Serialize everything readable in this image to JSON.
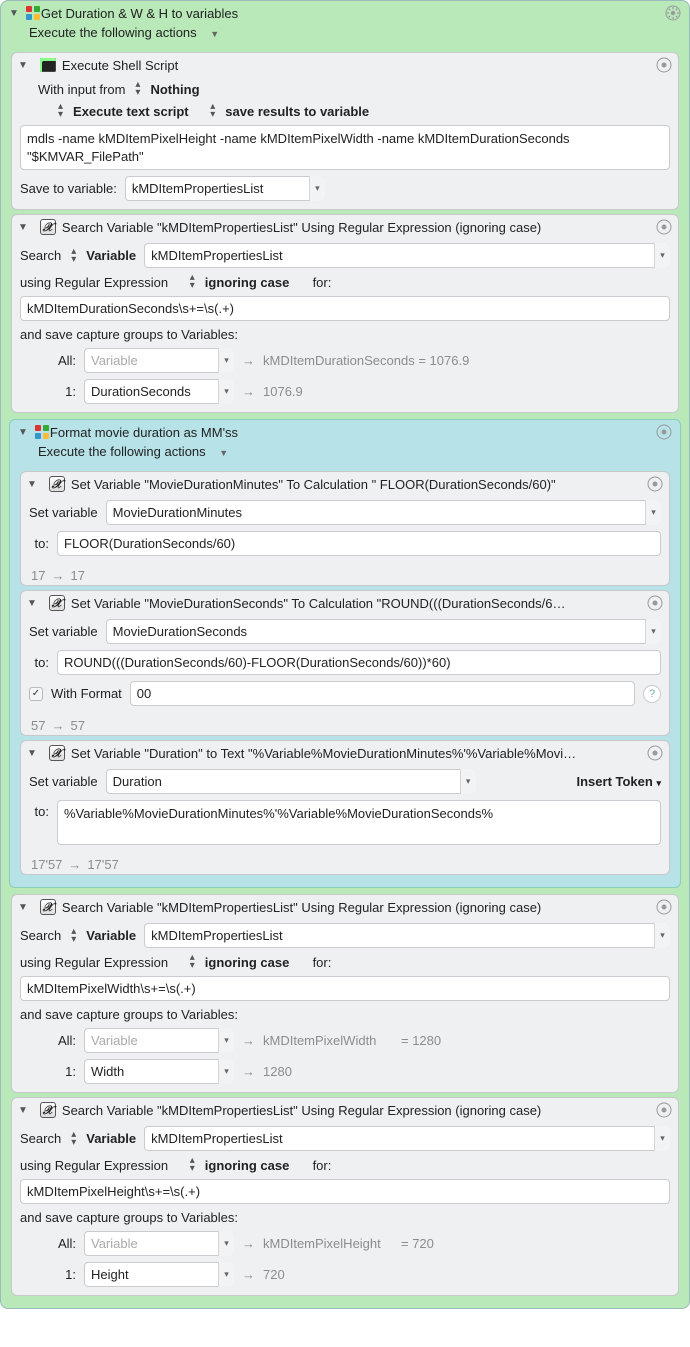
{
  "outer_group": {
    "title": "Get Duration & W & H to variables",
    "execute_label": "Execute the following actions"
  },
  "shell": {
    "title": "Execute Shell Script",
    "input_prefix": "With input from",
    "input_value": "Nothing",
    "mode1": "Execute text script",
    "mode2": "save results to variable",
    "script": "mdls -name kMDItemPixelHeight -name kMDItemPixelWidth -name kMDItemDurationSeconds \"$KMVAR_FilePath\"",
    "save_label": "Save to variable:",
    "save_var": "kMDItemPropertiesList"
  },
  "search_template": {
    "search_label": "Search",
    "variable_label": "Variable",
    "using_label": "using Regular Expression",
    "ignoring_label": "ignoring case",
    "for_label": "for:",
    "save_groups_label": "and save capture groups to Variables:",
    "all_label": "All:",
    "one_label": "1:",
    "var_placeholder": "Variable"
  },
  "search1": {
    "title": "Search Variable \"kMDItemPropertiesList\" Using Regular Expression (ignoring case)",
    "search_var": "kMDItemPropertiesList",
    "regex": "kMDItemDurationSeconds\\s+=\\s(.+)",
    "all_result": "kMDItemDurationSeconds = 1076.9",
    "one_var": "DurationSeconds",
    "one_result": "1076.9"
  },
  "inner_group": {
    "title": "Format movie duration as MM'ss",
    "execute_label": "Execute the following actions"
  },
  "setvar_labels": {
    "set_label": "Set variable",
    "to_label": "to:",
    "with_format_label": "With Format",
    "insert_token": "Insert Token"
  },
  "sv1": {
    "title": "Set Variable \"MovieDurationMinutes\" To Calculation \" FLOOR(DurationSeconds/60)\"",
    "var": "MovieDurationMinutes",
    "calc": "FLOOR(DurationSeconds/60)",
    "from": "17",
    "to": "17"
  },
  "sv2": {
    "title": "Set Variable \"MovieDurationSeconds\" To Calculation \"ROUND(((DurationSeconds/6…",
    "var": "MovieDurationSeconds",
    "calc": "ROUND(((DurationSeconds/60)-FLOOR(DurationSeconds/60))*60)",
    "format": "00",
    "from": "57",
    "to": "57"
  },
  "sv3": {
    "title": "Set Variable \"Duration\" to Text \"%Variable%MovieDurationMinutes%'%Variable%Movi…",
    "var": "Duration",
    "text": "%Variable%MovieDurationMinutes%'%Variable%MovieDurationSeconds%",
    "from": "17'57",
    "to": "17'57"
  },
  "search2": {
    "title": "Search Variable \"kMDItemPropertiesList\" Using Regular Expression (ignoring case)",
    "search_var": "kMDItemPropertiesList",
    "regex": "kMDItemPixelWidth\\s+=\\s(.+)",
    "all_result_a": "kMDItemPixelWidth",
    "all_result_b": "= 1280",
    "one_var": "Width",
    "one_result": "1280"
  },
  "search3": {
    "title": "Search Variable \"kMDItemPropertiesList\" Using Regular Expression (ignoring case)",
    "search_var": "kMDItemPropertiesList",
    "regex": "kMDItemPixelHeight\\s+=\\s(.+)",
    "all_result_a": "kMDItemPixelHeight",
    "all_result_b": "= 720",
    "one_var": "Height",
    "one_result": "720"
  }
}
